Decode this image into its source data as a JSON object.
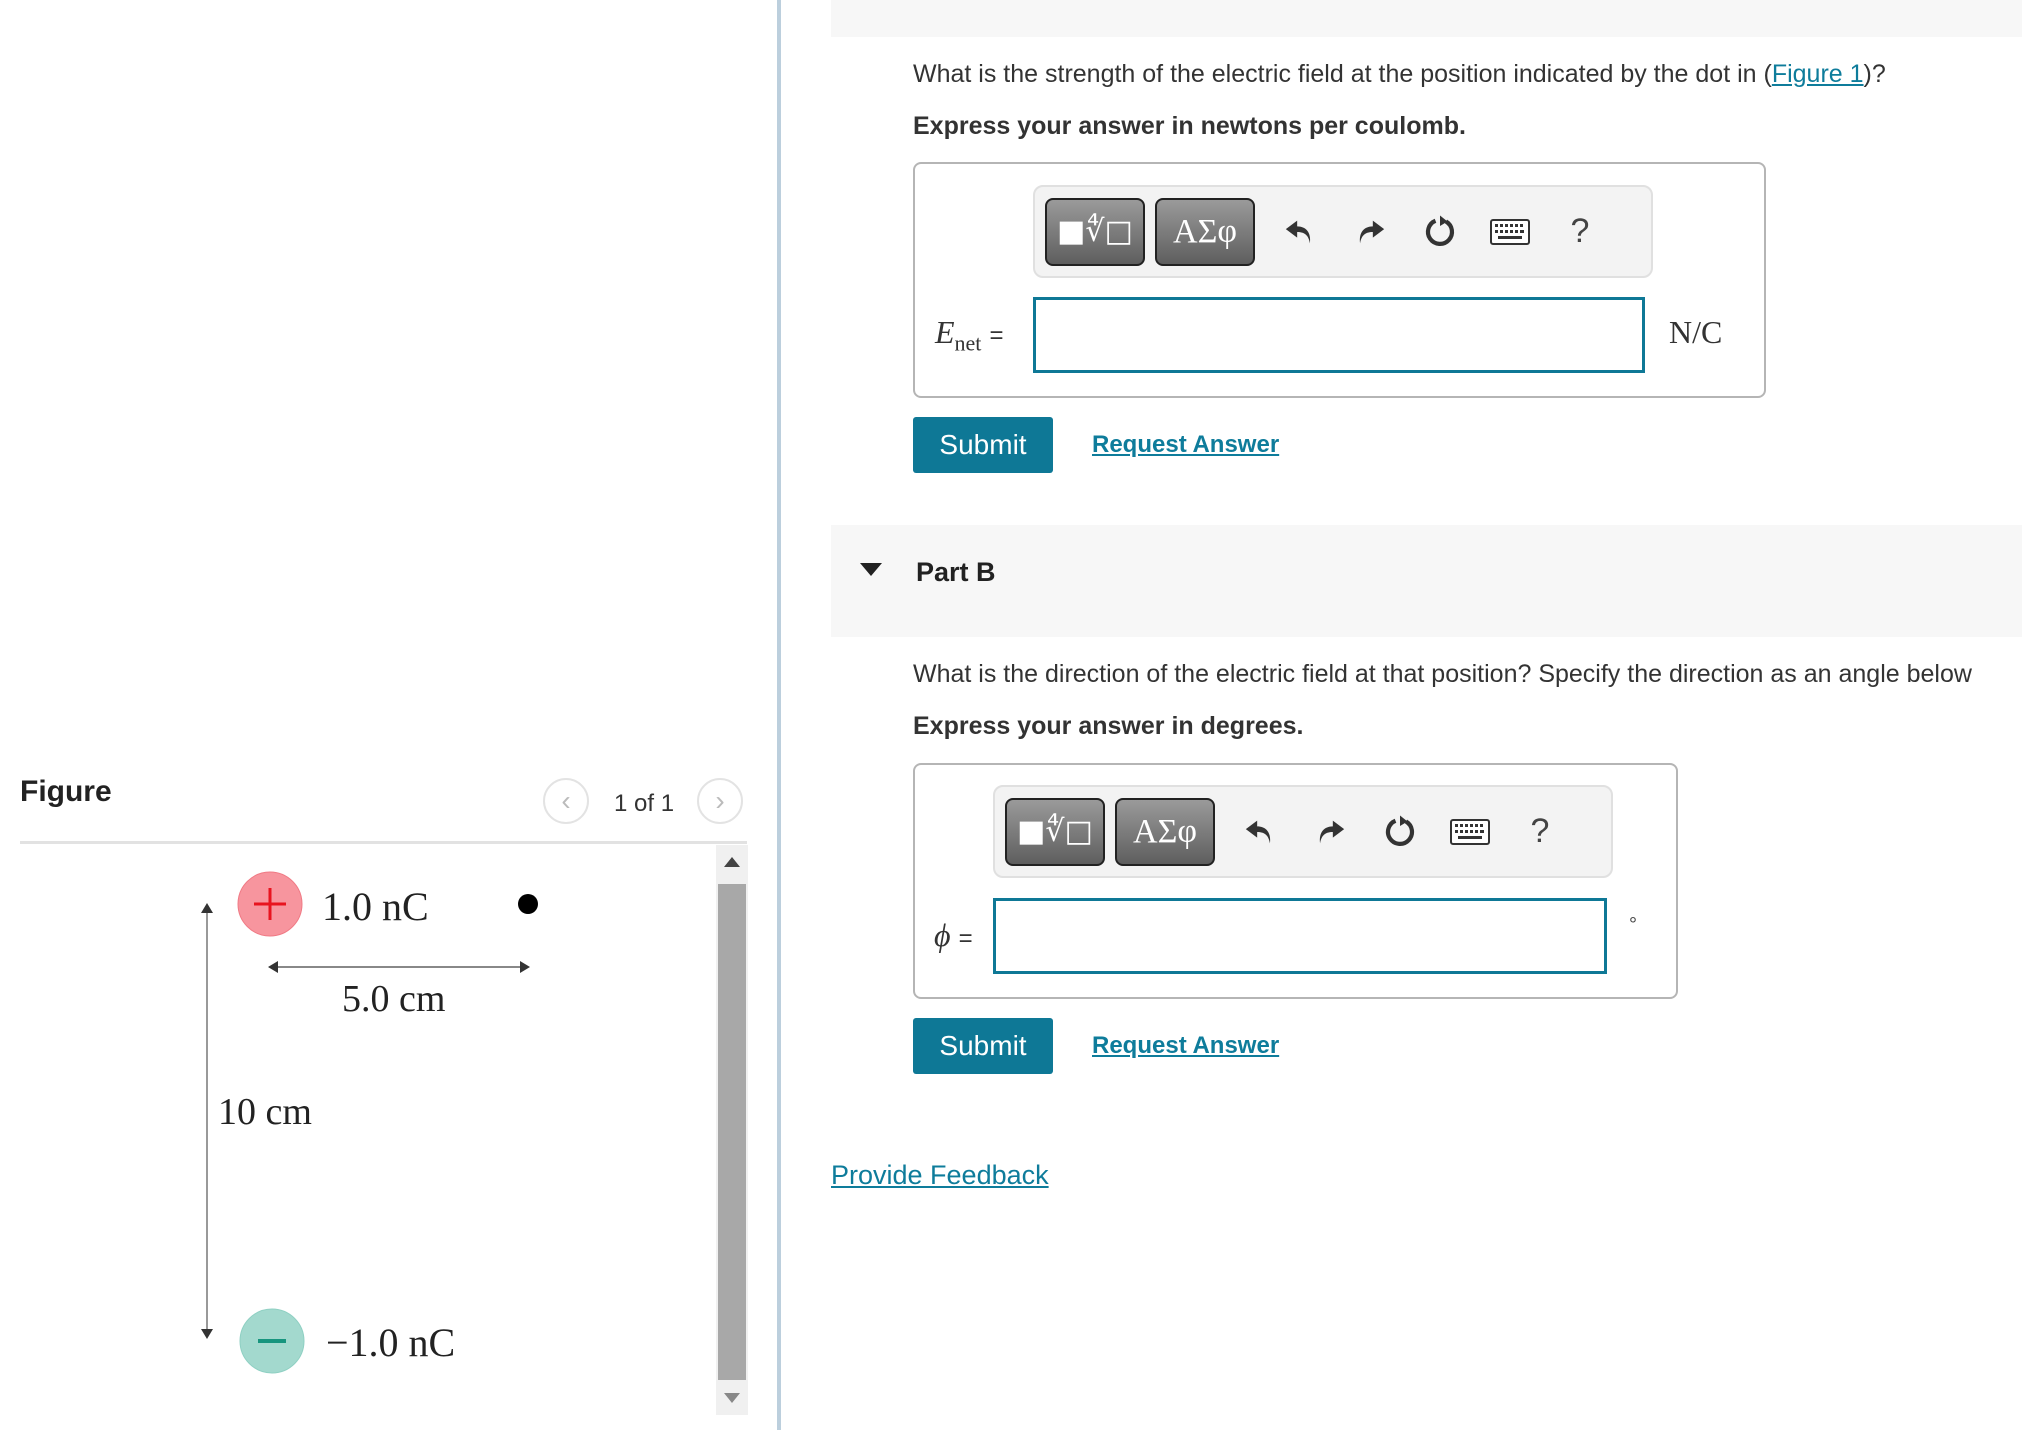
{
  "figure_panel": {
    "title": "Figure",
    "pager": {
      "prev_icon": "‹",
      "next_icon": "›",
      "text": "1 of 1"
    },
    "diagram": {
      "positive_charge": {
        "sign": "+",
        "label": "1.0 nC",
        "color": "#f48a95",
        "sign_color": "#e8141f"
      },
      "negative_charge": {
        "sign": "−",
        "label": "−1.0 nC",
        "color": "#9fd8cc",
        "sign_color": "#17957e"
      },
      "horizontal_distance": "5.0 cm",
      "vertical_distance": "10 cm"
    }
  },
  "part_a": {
    "question": "What is the strength of the electric field at the position indicated by the dot in (",
    "figure_link": "Figure 1",
    "question_end": ")?",
    "instruction": "Express your answer in newtons per coulomb.",
    "toolbar": {
      "templates_icon": "■∜□",
      "greek_label": "ΑΣφ",
      "undo_icon": "undo",
      "redo_icon": "redo",
      "reset_icon": "reset",
      "keyboard_icon": "keyboard",
      "help_label": "?"
    },
    "variable": "E",
    "subscript": "net",
    "equals": "=",
    "input_value": "",
    "unit": "N/C",
    "submit_label": "Submit",
    "request_answer_label": "Request Answer"
  },
  "part_b": {
    "header": "Part B",
    "question": "What is the direction of the electric field at that position? Specify the direction as an angle below",
    "instruction": "Express your answer in degrees.",
    "toolbar": {
      "templates_icon": "■∜□",
      "greek_label": "ΑΣφ",
      "help_label": "?"
    },
    "variable": "ϕ",
    "equals": "=",
    "input_value": "",
    "unit": "°",
    "submit_label": "Submit",
    "request_answer_label": "Request Answer"
  },
  "feedback_link": "Provide Feedback",
  "colors": {
    "accent": "#0e7896",
    "link": "#0e7c9b",
    "divider": "#bccfdd"
  }
}
